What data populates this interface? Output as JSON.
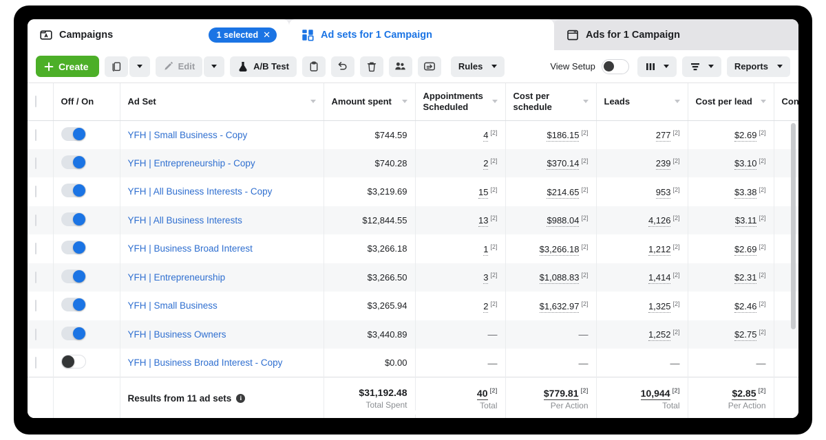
{
  "tabs": [
    {
      "label": "Campaigns",
      "icon": "folder-icon",
      "badge": "1 selected",
      "badge_close": "✕",
      "active": true,
      "accent": "#1b74e4"
    },
    {
      "label": "Ad sets for 1 Campaign",
      "icon": "grid-icon",
      "active": true,
      "accent": "#1b74e4"
    },
    {
      "label": "Ads for 1 Campaign",
      "icon": "window-icon",
      "active": false
    }
  ],
  "toolbar": {
    "create_label": "Create",
    "create_icon": "plus-icon",
    "create_color": "#4caf28",
    "duplicate_icon": "duplicate-icon",
    "duplicate_caret_icon": "chevron-down-icon",
    "edit_label": "Edit",
    "edit_icon": "pencil-icon",
    "edit_caret_icon": "chevron-down-icon",
    "abtest_label": "A/B Test",
    "abtest_icon": "flask-icon",
    "clipboard_icon": "clipboard-icon",
    "undo_icon": "undo-arrow-icon",
    "delete_icon": "trash-icon",
    "audience_icon": "people-icon",
    "export_icon": "share-arrow-icon",
    "rules_label": "Rules",
    "rules_caret_icon": "chevron-down-icon",
    "view_setup_label": "View Setup",
    "view_setup_toggle": "view-setup-toggle",
    "columns_icon": "columns-icon",
    "columns_caret_icon": "chevron-down-icon",
    "breakdown_icon": "breakdown-icon",
    "breakdown_caret_icon": "chevron-down-icon",
    "reports_label": "Reports",
    "reports_caret_icon": "chevron-down-icon"
  },
  "table": {
    "columns": [
      {
        "key": "check",
        "label": ""
      },
      {
        "key": "toggle",
        "label": "Off / On",
        "sortable": false
      },
      {
        "key": "adset",
        "label": "Ad Set",
        "sortable": true
      },
      {
        "key": "spent",
        "label": "Amount spent",
        "sortable": true
      },
      {
        "key": "appt",
        "label": "Appointments\nScheduled",
        "sortable": true
      },
      {
        "key": "cps",
        "label": "Cost per\nschedule",
        "sortable": true
      },
      {
        "key": "leads",
        "label": "Leads",
        "sortable": true
      },
      {
        "key": "cpl",
        "label": "Cost per lead",
        "sortable": true
      },
      {
        "key": "contacts",
        "label": "Contacts",
        "sortable": false
      }
    ],
    "column_labels": {
      "check": "",
      "toggle": "Off / On",
      "adset": "Ad Set",
      "spent": "Amount spent",
      "appt_line1": "Appointments",
      "appt_line2": "Scheduled",
      "cps_line1": "Cost per",
      "cps_line2": "schedule",
      "leads": "Leads",
      "cpl": "Cost per lead",
      "contacts": "Contacts"
    },
    "superscript": "[2]",
    "dash": "—",
    "rows": [
      {
        "on": true,
        "adset": "YFH | Small Business - Copy",
        "spent": "$744.59",
        "appt": "4",
        "cps": "$186.15",
        "leads": "277",
        "cpl": "$2.69",
        "contacts": ""
      },
      {
        "on": true,
        "adset": "YFH | Entrepreneurship - Copy",
        "spent": "$740.28",
        "appt": "2",
        "cps": "$370.14",
        "leads": "239",
        "cpl": "$3.10",
        "contacts": ""
      },
      {
        "on": true,
        "adset": "YFH | All Business Interests - Copy",
        "spent": "$3,219.69",
        "appt": "15",
        "cps": "$214.65",
        "leads": "953",
        "cpl": "$3.38",
        "contacts": ""
      },
      {
        "on": true,
        "adset": "YFH | All Business Interests",
        "spent": "$12,844.55",
        "appt": "13",
        "cps": "$988.04",
        "leads": "4,126",
        "cpl": "$3.11",
        "contacts": ""
      },
      {
        "on": true,
        "adset": "YFH | Business Broad Interest",
        "spent": "$3,266.18",
        "appt": "1",
        "cps": "$3,266.18",
        "leads": "1,212",
        "cpl": "$2.69",
        "contacts": ""
      },
      {
        "on": true,
        "adset": "YFH | Entrepreneurship",
        "spent": "$3,266.50",
        "appt": "3",
        "cps": "$1,088.83",
        "leads": "1,414",
        "cpl": "$2.31",
        "contacts": ""
      },
      {
        "on": true,
        "adset": "YFH | Small Business",
        "spent": "$3,265.94",
        "appt": "2",
        "cps": "$1,632.97",
        "leads": "1,325",
        "cpl": "$2.46",
        "contacts": ""
      },
      {
        "on": true,
        "adset": "YFH | Business Owners",
        "spent": "$3,440.89",
        "appt": "",
        "cps": "",
        "leads": "1,252",
        "cpl": "$2.75",
        "contacts": ""
      },
      {
        "on": false,
        "adset": "YFH | Business Broad Interest - Copy",
        "spent": "$0.00",
        "appt": "",
        "cps": "",
        "leads": "",
        "cpl": "",
        "contacts": ""
      }
    ],
    "summary": {
      "label": "Results from 11 ad sets",
      "info_icon": "info-icon",
      "info_glyph": "i",
      "spent_value": "$31,192.48",
      "spent_sub": "Total Spent",
      "appt_value": "40",
      "appt_sub": "Total",
      "cps_value": "$779.81",
      "cps_sub": "Per Action",
      "leads_value": "10,944",
      "leads_sub": "Total",
      "cpl_value": "$2.85",
      "cpl_sub": "Per Action",
      "contacts_value": "",
      "contacts_sub": ""
    }
  }
}
